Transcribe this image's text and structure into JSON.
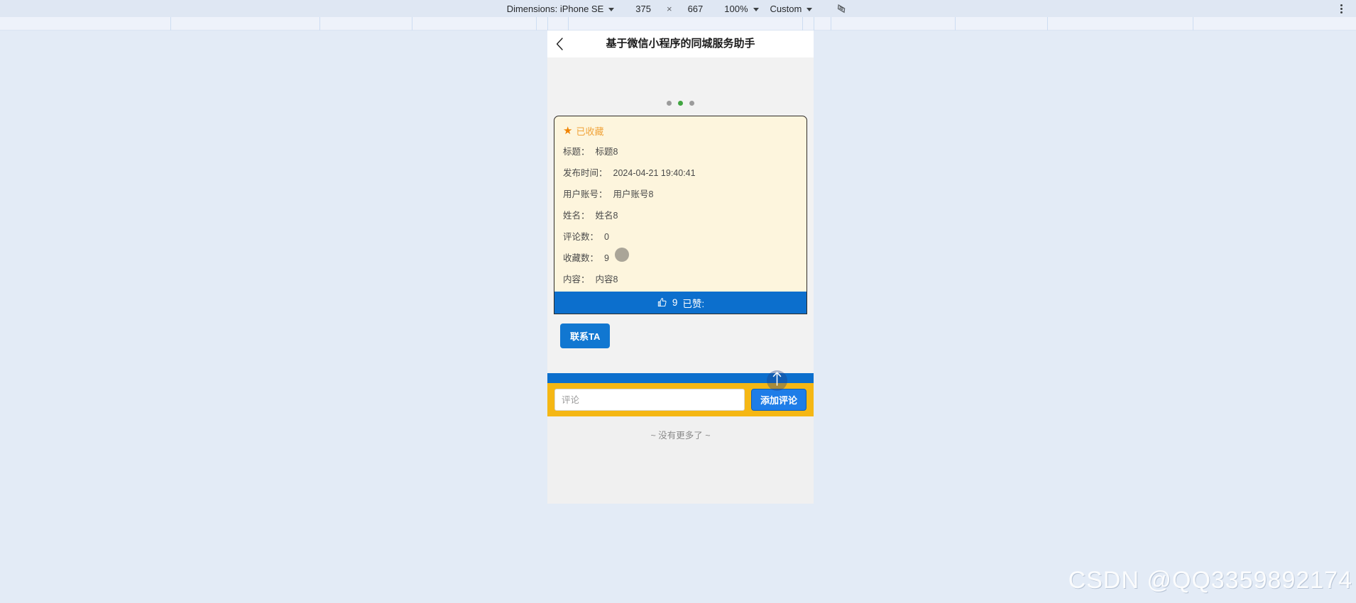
{
  "devtools_toolbar": {
    "dimensions_label": "Dimensions: iPhone SE",
    "width_value": "375",
    "times_symbol": "×",
    "height_value": "667",
    "zoom_value": "100%",
    "throttling_value": "Custom",
    "rotate_icon": "rotate-icon",
    "more_options_icon": "kebab-menu-icon"
  },
  "viewport": {
    "header": {
      "back_icon": "chevron-left-icon",
      "title": "基于微信小程序的同城服务助手"
    },
    "banner": {
      "dots": [
        "inactive",
        "active",
        "inactive"
      ],
      "active_index": 1,
      "active_color": "#41a541",
      "inactive_color": "#9b9b9b"
    },
    "post_card": {
      "favorite": {
        "star_icon": "star-filled-icon",
        "label": "已收藏",
        "star_color": "#f08300",
        "label_color": "#f0a33a"
      },
      "fields": [
        {
          "key": "标题：",
          "value": "标题8"
        },
        {
          "key": "发布时间：",
          "value": "2024-04-21 19:40:41"
        },
        {
          "key": "用户账号：",
          "value": "用户账号8"
        },
        {
          "key": "姓名：",
          "value": "姓名8"
        },
        {
          "key": "评论数：",
          "value": "0"
        },
        {
          "key": "收藏数：",
          "value": "9"
        },
        {
          "key": "内容：",
          "value": "内容8"
        }
      ],
      "like_bar": {
        "icon": "thumbs-up-icon",
        "count": "9",
        "label": "已赞:",
        "background": "#0c6fcd"
      },
      "card_background": "#fdf5dd",
      "card_border": "#2e2b26"
    },
    "contact_button": {
      "label": "联系TA",
      "background": "#1177d1"
    },
    "comment_bar": {
      "background": "#f5b714",
      "input_value": "",
      "input_placeholder": "评论",
      "add_button_label": "添加评论",
      "add_button_background": "#1e7de8",
      "cursor_icon": "arrow-up-cursor-icon"
    },
    "no_more_text": "~ 没有更多了 ~"
  },
  "watermark": {
    "text": "CSDN @QQ3359892174"
  }
}
